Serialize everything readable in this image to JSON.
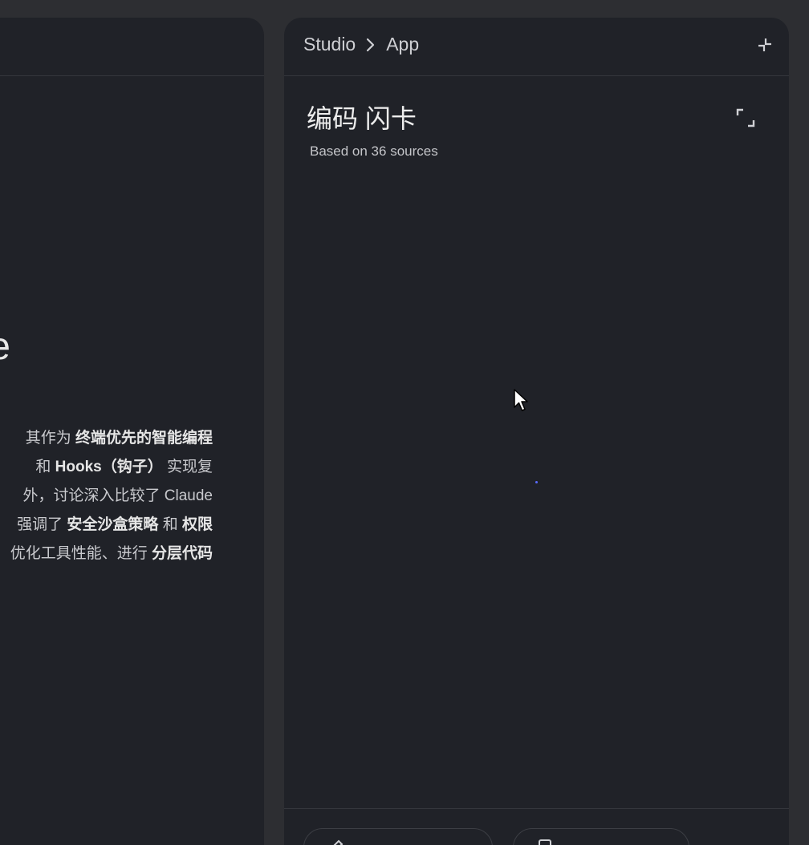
{
  "left_panel": {
    "big_title_fragment": "e",
    "summary_lines": [
      [
        {
          "t": "其作为 ",
          "b": false
        },
        {
          "t": "终端优先的智能编程",
          "b": true
        }
      ],
      [
        {
          "t": " 和 ",
          "b": false
        },
        {
          "t": "Hooks（钩子）",
          "b": true
        },
        {
          "t": " 实现复",
          "b": false
        }
      ],
      [
        {
          "t": "外，讨论深入比较了 Claude",
          "b": false
        }
      ],
      [
        {
          "t": "强调了 ",
          "b": false
        },
        {
          "t": "安全沙盒策略",
          "b": true
        },
        {
          "t": " 和 ",
          "b": false
        },
        {
          "t": "权限",
          "b": true
        }
      ],
      [
        {
          "t": "优化工具性能、进行 ",
          "b": false
        },
        {
          "t": "分层代码",
          "b": true
        }
      ]
    ]
  },
  "right_panel": {
    "breadcrumb": {
      "root": "Studio",
      "current": "App"
    },
    "title": "编码 闪卡",
    "subtitle": "Based on 36 sources",
    "icons": {
      "collapse": "collapse-icon",
      "expand": "fullscreen-icon",
      "separator": "chevron-right-icon"
    },
    "accent_color": "#5a6cff"
  }
}
